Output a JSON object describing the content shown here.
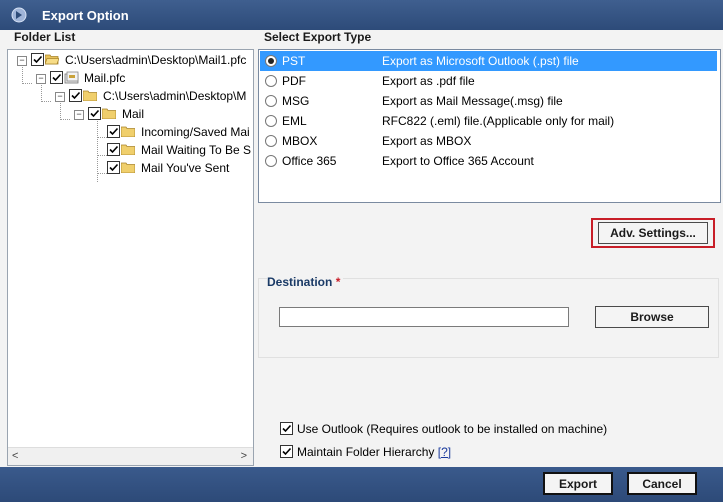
{
  "window": {
    "title": "Export Option",
    "icon": "app-logo-icon"
  },
  "folder_list": {
    "label": "Folder List",
    "nodes": [
      {
        "label": "C:\\Users\\admin\\Desktop\\Mail1.pfc",
        "icon": "open-folder-icon",
        "checked": true
      },
      {
        "label": "Mail.pfc",
        "icon": "pfc-file-icon",
        "checked": true
      },
      {
        "label": "C:\\Users\\admin\\Desktop\\M",
        "icon": "folder-icon",
        "checked": true
      },
      {
        "label": "Mail",
        "icon": "folder-icon",
        "checked": true
      },
      {
        "label": "Incoming/Saved Mai",
        "icon": "folder-icon",
        "checked": true
      },
      {
        "label": "Mail Waiting To Be S",
        "icon": "folder-icon",
        "checked": true
      },
      {
        "label": "Mail You've Sent",
        "icon": "folder-icon",
        "checked": true
      }
    ],
    "scroll_left": "<",
    "scroll_right": ">"
  },
  "export_type": {
    "label": "Select Export Type",
    "selected": "PST",
    "options": [
      {
        "name": "PST",
        "description": "Export as Microsoft Outlook (.pst) file"
      },
      {
        "name": "PDF",
        "description": "Export as .pdf file"
      },
      {
        "name": "MSG",
        "description": "Export as Mail Message(.msg) file"
      },
      {
        "name": "EML",
        "description": "RFC822 (.eml) file.(Applicable only for mail)"
      },
      {
        "name": "MBOX",
        "description": "Export as MBOX"
      },
      {
        "name": "Office 365",
        "description": "Export to Office 365 Account"
      }
    ]
  },
  "adv_settings_label": "Adv. Settings...",
  "destination": {
    "label": "Destination",
    "required_mark": "*",
    "value": "",
    "browse_label": "Browse"
  },
  "options": {
    "use_outlook": {
      "label": "Use Outlook (Requires outlook to be installed on machine)",
      "checked": true
    },
    "maintain_hierarchy": {
      "label": "Maintain Folder Hierarchy",
      "help": "[?]",
      "checked": true
    }
  },
  "footer": {
    "export_label": "Export",
    "cancel_label": "Cancel"
  },
  "colors": {
    "title_bar": "#2d4b79",
    "selection": "#3399ff",
    "highlight_outline": "#c81e28"
  }
}
